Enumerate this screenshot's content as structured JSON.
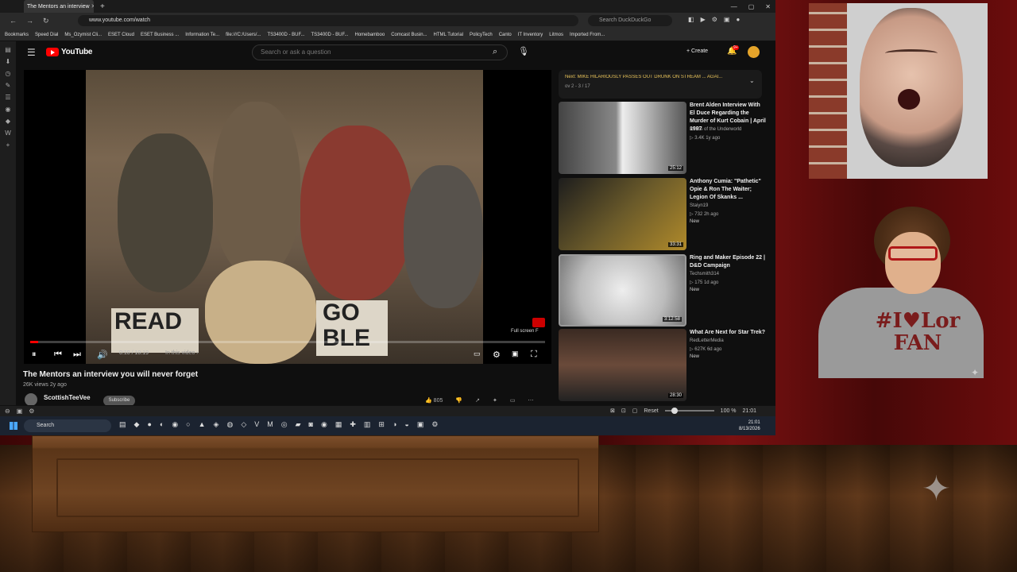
{
  "browser": {
    "tab_title": "The Mentors an interview",
    "url": "www.youtube.com/watch",
    "search_placeholder": "Search DuckDuckGo",
    "bookmarks": [
      "Bookmarks",
      "Speed Dial",
      "Ms_Ozymist Cli...",
      "ESET Cloud",
      "ESET Business ...",
      "Information Te...",
      "file:///C:/Users/...",
      "TS3400D - BUF...",
      "TS3400D - BUF...",
      "Homebamboo",
      "Comcast Busin...",
      "HTML Tutorial",
      "PolicyTech",
      "Canto",
      "IT Inventory",
      "Litmos",
      "Imported From..."
    ]
  },
  "youtube": {
    "logo": "YouTube",
    "search_placeholder": "Search or ask a question",
    "create_label": "Create",
    "notif_count": "9+",
    "player": {
      "progress_fraction": 0.016,
      "timecode": "0:10 / 10:19",
      "chapter": "In this video ›",
      "fullscreen_tip": "Full screen  F",
      "sign_left": "READ",
      "sign_right": "GO BLE"
    },
    "video": {
      "title": "The Mentors an interview you will never forget",
      "meta": "26K views  2y ago",
      "channel": "ScottishTeeVee",
      "subscribe": "Subscribe",
      "likes": "805"
    },
    "up_next": {
      "title": "Next: MIKE HILARIOUSLY PASSES OUT DRUNK ON STREAM ... AGAI...",
      "count": "ov 2 - 3 / 17"
    },
    "recommendations": [
      {
        "title": "Brent Alden Interview With El Duce Regarding the Murder of Kurt Cobain | April 1997",
        "channel": "Relics of the Underworld",
        "views": "▷ 3.4K  1y ago",
        "badge": "",
        "duration": "25:12"
      },
      {
        "title": "Anthony Cumia: \"Pathetic\" Opie & Ron The Waiter; Legion Of Skanks ...",
        "channel": "Staiyn19",
        "views": "▷ 732  2h ago",
        "badge": "New",
        "duration": "33:31"
      },
      {
        "title": "Ring and Maker Episode 22 | D&D Campaign",
        "channel": "Techsmith314",
        "views": "▷ 175  1d ago",
        "badge": "New",
        "duration": "3:12:58"
      },
      {
        "title": "What Are Next for Star Trek?",
        "channel": "RedLetterMedia",
        "views": "▷ 627K  6d ago",
        "badge": "New",
        "duration": "28:30"
      }
    ]
  },
  "statusbar": {
    "reset": "Reset",
    "zoom": "100 %",
    "time": "21:01"
  },
  "taskbar": {
    "search": "Search",
    "clock_time": "21:01",
    "clock_date": "8/13/2026"
  },
  "overlay": {
    "shirt_text": "#I♥Lor FAN"
  }
}
